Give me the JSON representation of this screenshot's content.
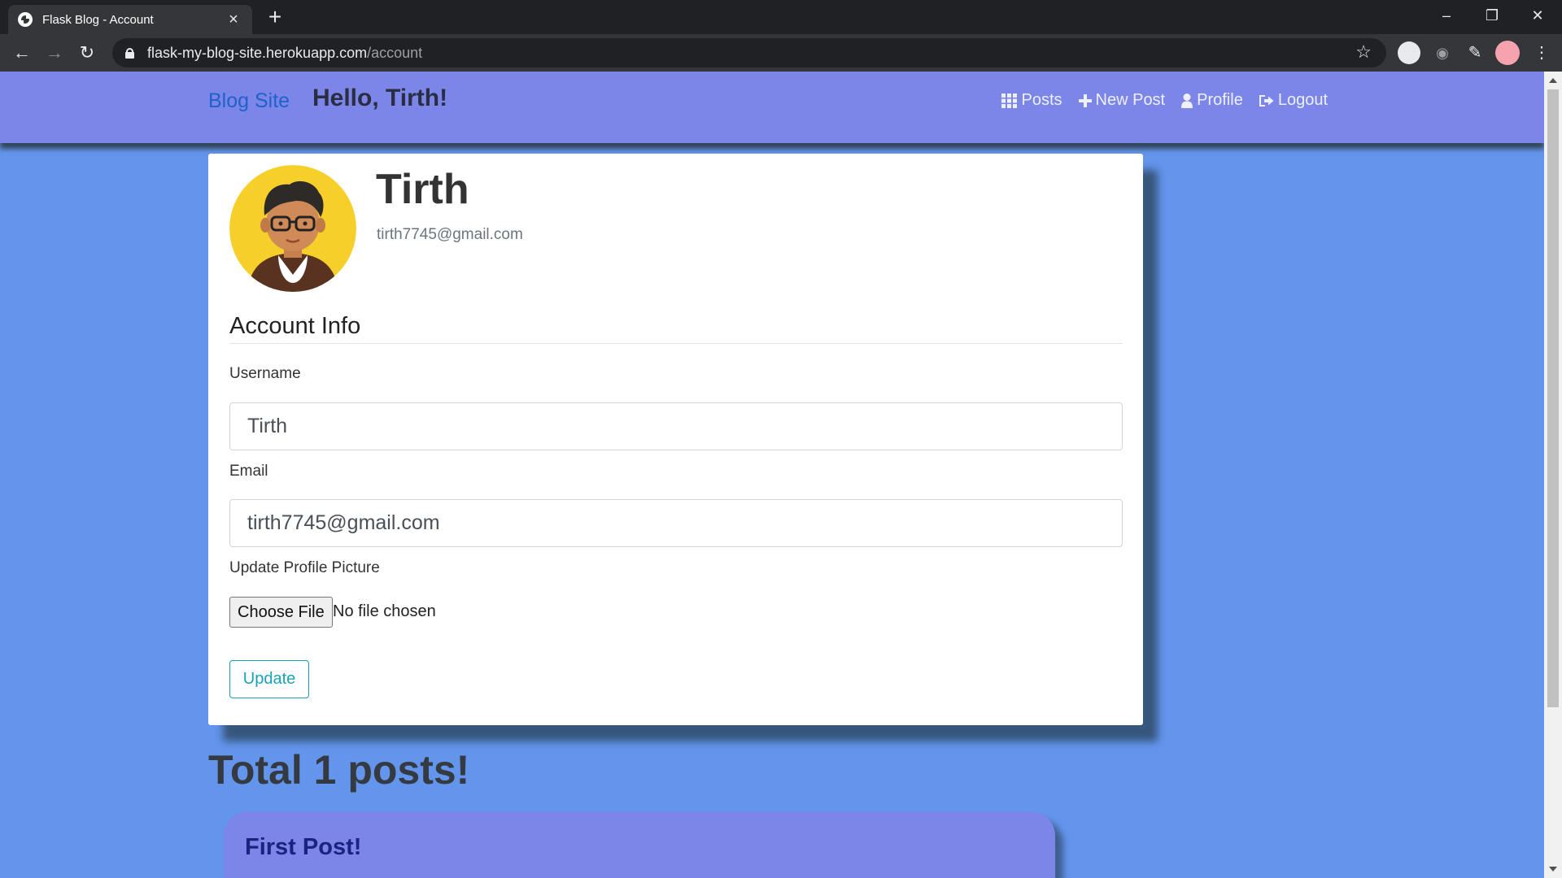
{
  "browser": {
    "tab_title": "Flask Blog - Account",
    "close_glyph": "×",
    "new_tab_glyph": "+",
    "url_domain": "flask-my-blog-site.herokuapp.com",
    "url_path": "/account"
  },
  "navbar": {
    "brand": "Blog Site",
    "greeting": "Hello, Tirth!",
    "links": [
      {
        "label": "Posts",
        "icon": "grid-icon"
      },
      {
        "label": "New Post",
        "icon": "plus-icon"
      },
      {
        "label": "Profile",
        "icon": "user-icon"
      },
      {
        "label": "Logout",
        "icon": "logout-icon"
      }
    ]
  },
  "profile": {
    "username": "Tirth",
    "email": "tirth7745@gmail.com"
  },
  "form": {
    "legend": "Account Info",
    "username_label": "Username",
    "username_value": "Tirth",
    "email_label": "Email",
    "email_value": "tirth7745@gmail.com",
    "picture_label": "Update Profile Picture",
    "choose_file": "Choose File",
    "no_file": "No file chosen",
    "submit": "Update"
  },
  "posts": {
    "total_text": "Total 1 posts!",
    "items": [
      {
        "title": "First Post!"
      }
    ]
  },
  "colors": {
    "page_bg": "#6495ed",
    "navbar_bg": "#7b86e8",
    "brand": "#1f62c9",
    "update_outline": "#17a2b8"
  }
}
